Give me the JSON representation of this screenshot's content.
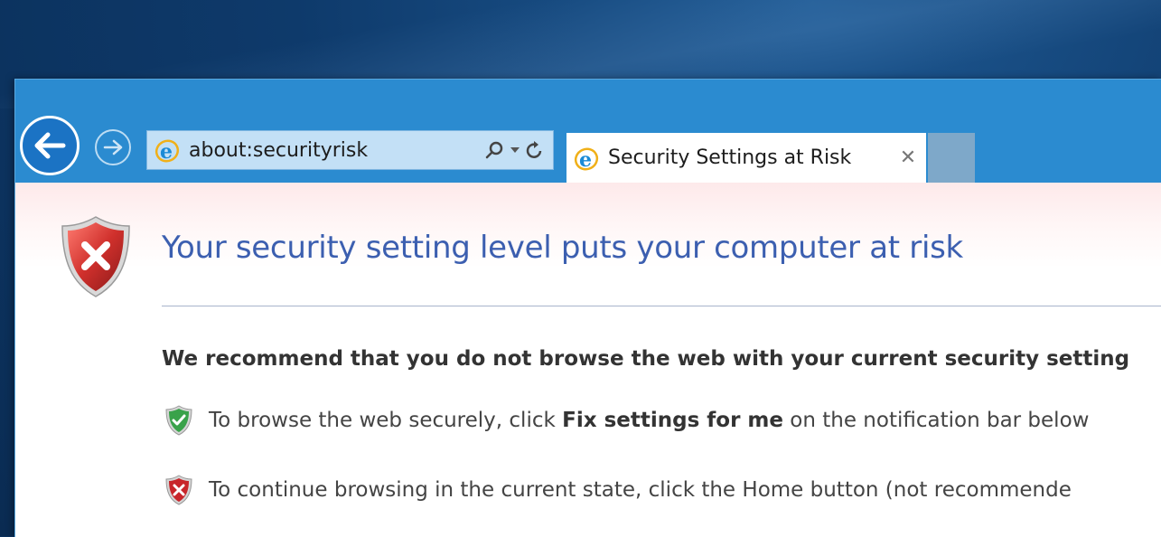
{
  "browser": {
    "address": "about:securityrisk",
    "tab_title": "Security Settings at Risk",
    "tab_close": "✕"
  },
  "page": {
    "headline": "Your security setting level puts your computer at risk",
    "recommendation": "We recommend that you do not browse the web with your current security setting",
    "option_fix": {
      "prefix": "To browse the web securely, click ",
      "bold": "Fix settings for me",
      "suffix": " on the notification bar below"
    },
    "option_continue": "To continue browsing in the current state, click the Home button (not recommende"
  },
  "icons": {
    "back": "back-arrow-icon",
    "forward": "forward-arrow-icon",
    "ie": "internet-explorer-icon",
    "search": "search-icon",
    "dropdown": "chevron-down-icon",
    "refresh": "refresh-icon",
    "shield_error": "shield-error-icon",
    "shield_ok": "shield-check-icon"
  },
  "colors": {
    "chrome": "#2b8bd0",
    "headline": "#3c5fb0",
    "shield_red": "#c8262b",
    "shield_green": "#3aa24a"
  }
}
